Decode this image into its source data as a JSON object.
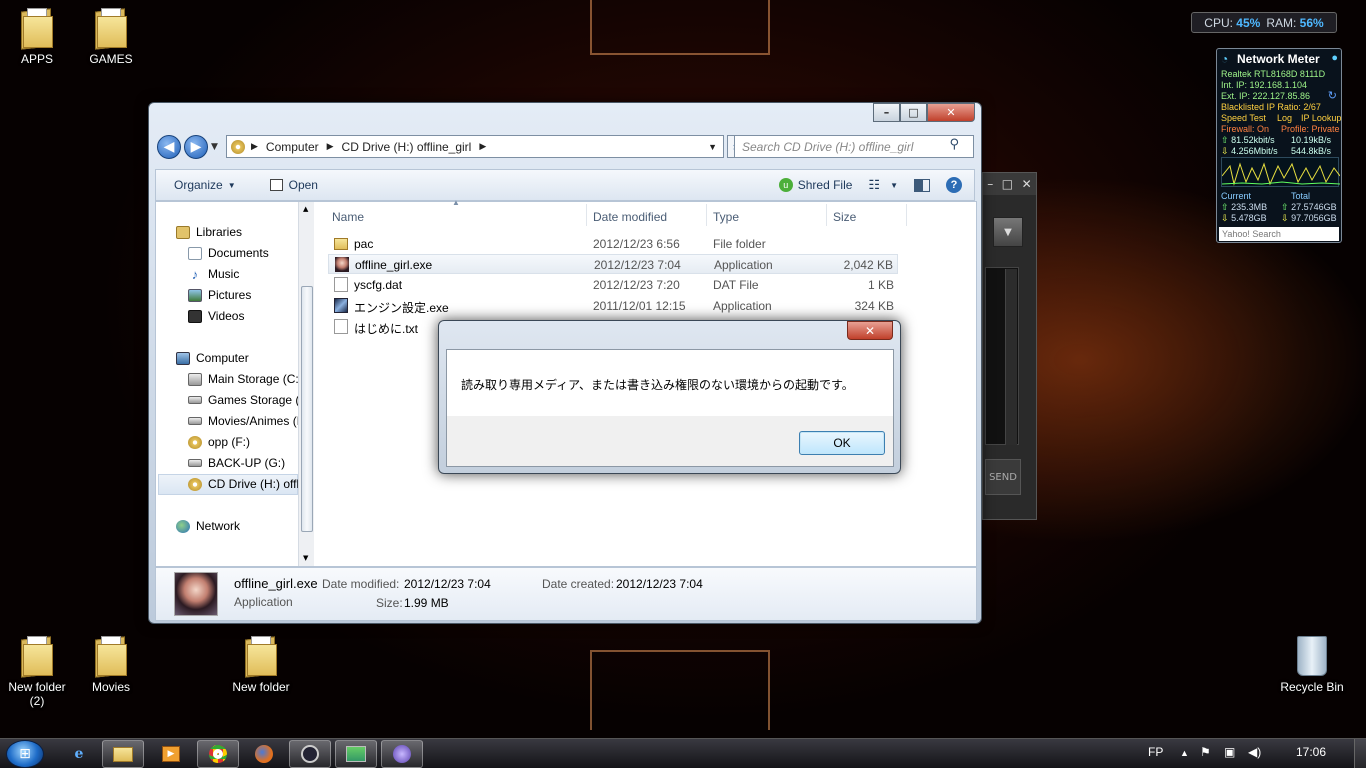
{
  "desktop": {
    "icons": [
      {
        "label": "APPS"
      },
      {
        "label": "GAMES"
      },
      {
        "label": "New folder (2)"
      },
      {
        "label": "Movies"
      },
      {
        "label": "New folder"
      },
      {
        "label": "Recycle Bin"
      }
    ]
  },
  "explorer": {
    "caption": {
      "minimize": "–",
      "maximize": "□",
      "close": "✕"
    },
    "address": {
      "segments": [
        "Computer",
        "CD Drive (H:) offline_girl"
      ]
    },
    "search_placeholder": "Search CD Drive (H:) offline_girl",
    "toolbar": {
      "organize": "Organize",
      "open": "Open",
      "shred": "Shred File"
    },
    "nav": {
      "libraries": "Libraries",
      "documents": "Documents",
      "music": "Music",
      "pictures": "Pictures",
      "videos": "Videos",
      "computer": "Computer",
      "main_storage": "Main Storage (C:)",
      "games_storage": "Games Storage (D:)",
      "movies_animes": "Movies/Animes (E:)",
      "opp": "opp (F:)",
      "backup": "BACK-UP (G:)",
      "cd_drive": "CD Drive (H:) offline_girl",
      "network": "Network"
    },
    "columns": {
      "name": "Name",
      "date": "Date modified",
      "type": "Type",
      "size": "Size"
    },
    "files": [
      {
        "name": "pac",
        "date": "2012/12/23 6:56",
        "type": "File folder",
        "size": ""
      },
      {
        "name": "offline_girl.exe",
        "date": "2012/12/23 7:04",
        "type": "Application",
        "size": "2,042 KB"
      },
      {
        "name": "yscfg.dat",
        "date": "2012/12/23 7:20",
        "type": "DAT File",
        "size": "1 KB"
      },
      {
        "name": "エンジン設定.exe",
        "date": "2011/12/01 12:15",
        "type": "Application",
        "size": "324 KB"
      },
      {
        "name": "はじめに.txt",
        "date": "",
        "type": "",
        "size": ""
      }
    ],
    "details": {
      "filename": "offline_girl.exe",
      "filetype": "Application",
      "modified_label": "Date modified:",
      "modified": "2012/12/23 7:04",
      "created_label": "Date created:",
      "created": "2012/12/23 7:04",
      "size_label": "Size:",
      "size": "1.99 MB"
    }
  },
  "dialog": {
    "close": "✕",
    "message": "読み取り専用メディア、または書き込み権限のない環境からの起動です。",
    "ok": "OK"
  },
  "bg_window": {
    "send": "SEND"
  },
  "gadgets": {
    "cpu_label": "CPU:",
    "cpu_value": "45%",
    "ram_label": "RAM:",
    "ram_value": "56%",
    "network_meter": {
      "title": "Network Meter",
      "adapter": "Realtek RTL8168D 8111D",
      "int_ip": "Int. IP: 192.168.1.104",
      "ext_ip": "Ext. IP: 222.127.85.86",
      "blacklist": "Blacklisted IP Ratio: 2/67",
      "speed_test": "Speed Test",
      "log": "Log",
      "ip_lookup": "IP Lookup",
      "firewall": "Firewall: On",
      "profile": "Profile: Private",
      "up_rate_bits": "81.52kbit/s",
      "up_rate_bytes": "10.19kB/s",
      "down_rate_bits": "4.256Mbit/s",
      "down_rate_bytes": "544.8kB/s",
      "current_label": "Current",
      "total_label": "Total",
      "cur_up": "235.3MB",
      "cur_down": "5.478GB",
      "tot_up": "27.5746GB",
      "tot_down": "97.7056GB",
      "search_placeholder": "Yahoo! Search"
    }
  },
  "taskbar": {
    "lang": "FP",
    "time": "17:06"
  },
  "colors": {
    "accent": "#1e5fb8",
    "gadget_blue": "#4fb8ff"
  }
}
